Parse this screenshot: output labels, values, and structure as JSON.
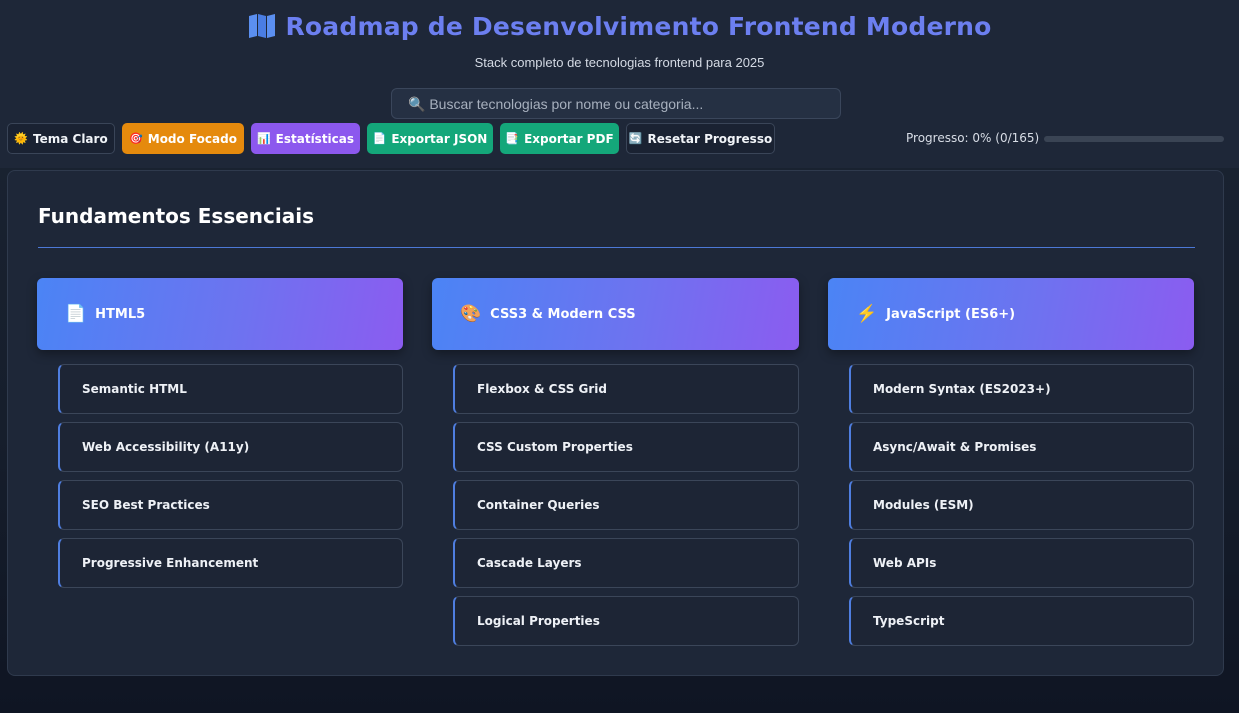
{
  "header": {
    "title": "Roadmap de Desenvolvimento Frontend Moderno",
    "subtitle": "Stack completo de tecnologias frontend para 2025",
    "title_icon": "book-map-icon",
    "accent": "#6c7ff0"
  },
  "search": {
    "placeholder": "🔍 Buscar tecnologias por nome ou categoria...",
    "value": ""
  },
  "toolbar": {
    "theme": {
      "icon": "🌞",
      "label": "Tema Claro"
    },
    "focus": {
      "icon": "🎯",
      "label": "Modo Focado"
    },
    "stats": {
      "icon": "📊",
      "label": "Estatísticas"
    },
    "export_json": {
      "icon": "📄",
      "label": "Exportar JSON"
    },
    "export_pdf": {
      "icon": "📑",
      "label": "Exportar PDF"
    },
    "reset": {
      "icon": "🔄",
      "label": "Resetar Progresso"
    }
  },
  "progress": {
    "label": "Progresso: 0% (0/165)",
    "percent": 0,
    "done": 0,
    "total": 165
  },
  "section": {
    "title": "Fundamentos Essenciais",
    "categories": [
      {
        "icon": "📄",
        "label": "HTML5",
        "items": [
          "Semantic HTML",
          "Web Accessibility (A11y)",
          "SEO Best Practices",
          "Progressive Enhancement"
        ]
      },
      {
        "icon": "🎨",
        "label": "CSS3 & Modern CSS",
        "items": [
          "Flexbox & CSS Grid",
          "CSS Custom Properties",
          "Container Queries",
          "Cascade Layers",
          "Logical Properties"
        ]
      },
      {
        "icon": "⚡",
        "label": "JavaScript (ES6+)",
        "items": [
          "Modern Syntax (ES2023+)",
          "Async/Await & Promises",
          "Modules (ESM)",
          "Web APIs",
          "TypeScript"
        ]
      }
    ]
  }
}
